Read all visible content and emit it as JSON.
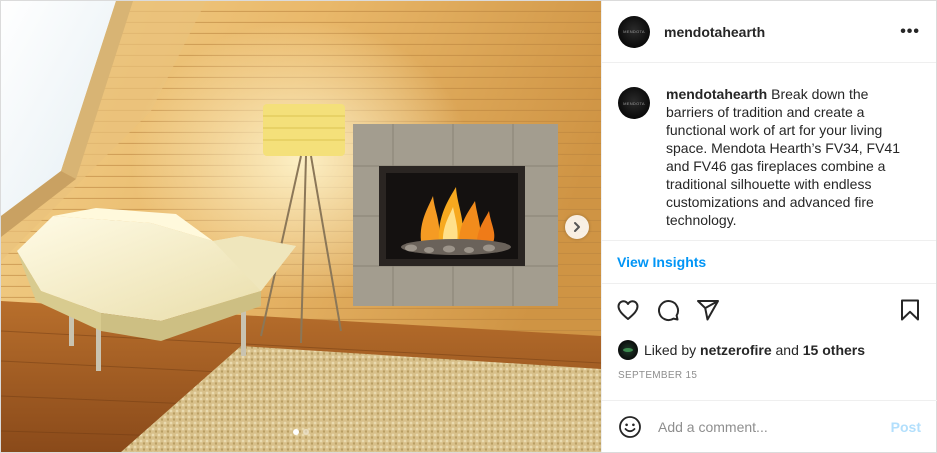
{
  "account": {
    "username": "mendotahearth",
    "avatar_text": "MENDOTA"
  },
  "header": {
    "more_label": "•••"
  },
  "caption": {
    "username": "mendotahearth",
    "text": "Break down the barriers of tradition and create a functional work of art for your living space. Mendota Hearth’s FV34, FV41 and FV46 gas fireplaces combine a traditional silhouette with endless customizations and advanced fire technology."
  },
  "insights": {
    "label": "View Insights"
  },
  "actions": {
    "icons": [
      "heart-icon",
      "comment-icon",
      "share-icon",
      "bookmark-icon"
    ]
  },
  "likes": {
    "prefix": "Liked by",
    "user": "netzerofire",
    "middle": "and",
    "others": "15 others"
  },
  "date": "SEPTEMBER 15",
  "comment": {
    "placeholder": "Add a comment...",
    "post_label": "Post"
  },
  "carousel": {
    "slide_count": 2,
    "active_index": 0
  },
  "colors": {
    "link_blue": "#0095f6",
    "post_disabled": "#b2dffc",
    "secondary_text": "#8e8e8e"
  }
}
